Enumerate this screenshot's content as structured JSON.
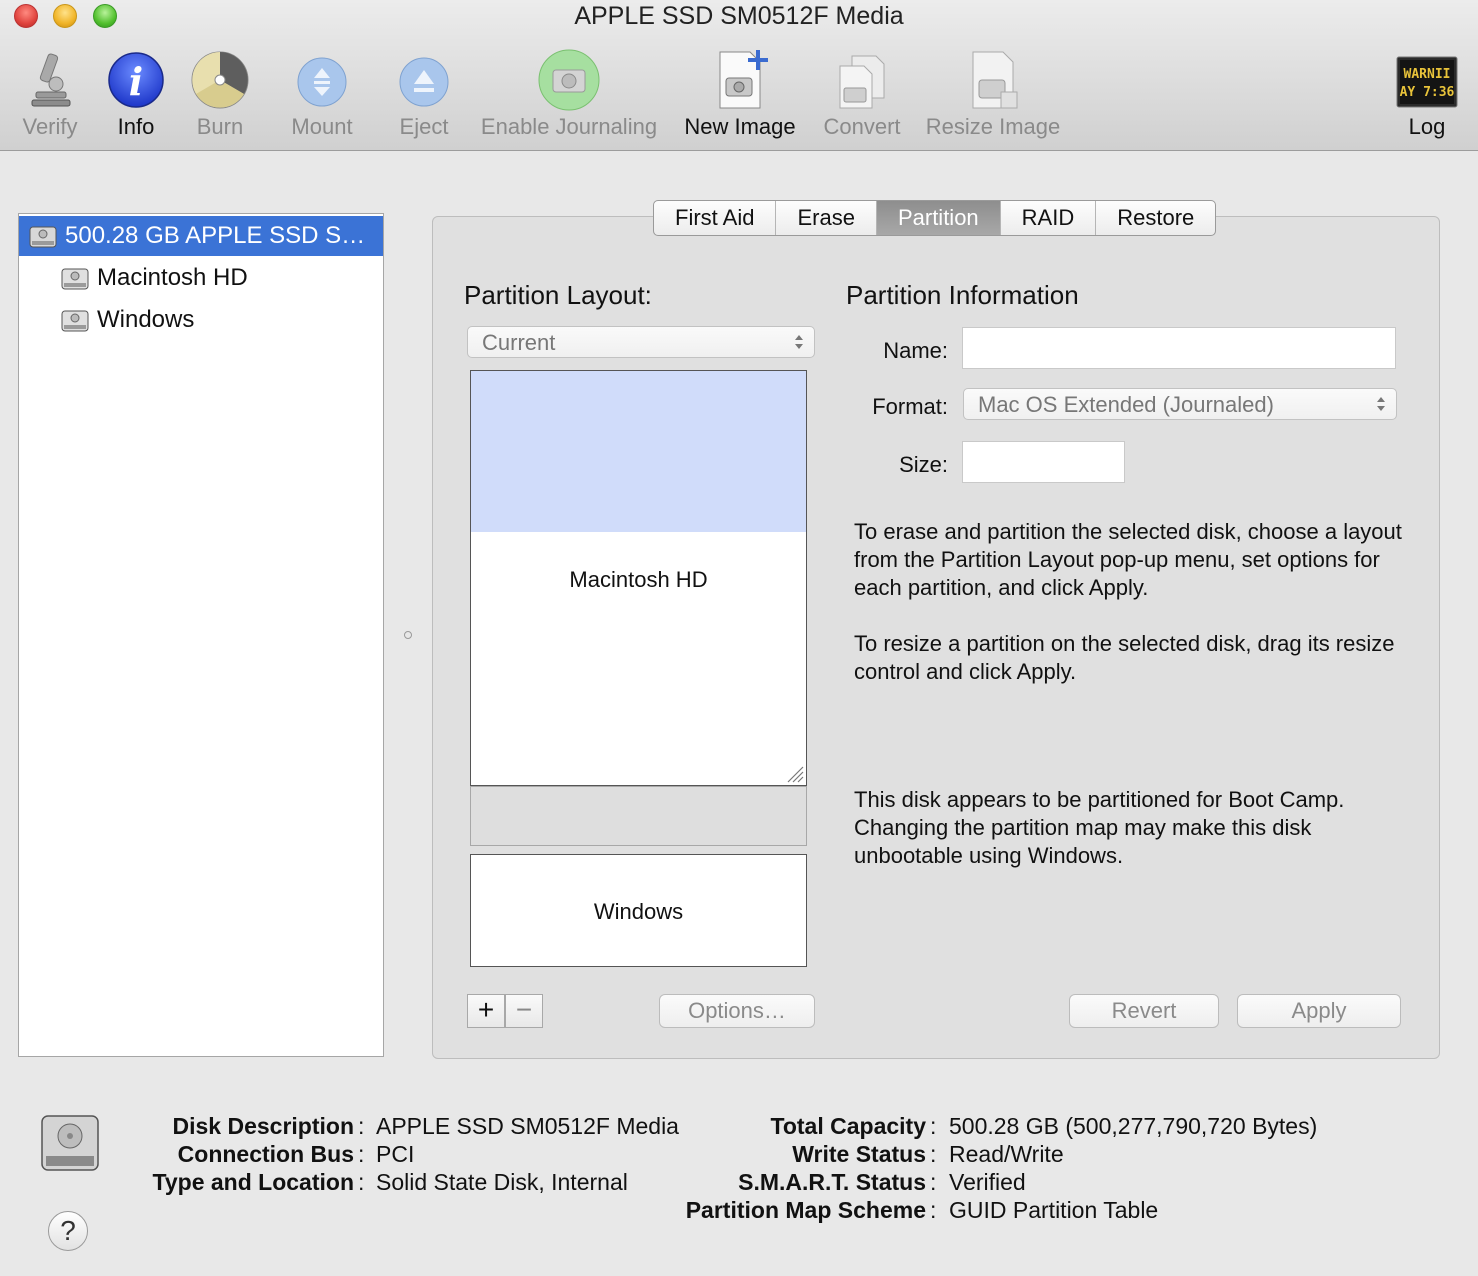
{
  "window": {
    "title": "APPLE SSD SM0512F Media"
  },
  "toolbar": {
    "verify": "Verify",
    "info": "Info",
    "burn": "Burn",
    "mount": "Mount",
    "eject": "Eject",
    "enable_journaling": "Enable Journaling",
    "new_image": "New Image",
    "convert": "Convert",
    "resize_image": "Resize Image",
    "log": "Log",
    "log_display_line1": "WARNII",
    "log_display_line2": "AY 7:36"
  },
  "sidebar": {
    "items": [
      {
        "label": "500.28 GB APPLE SSD S…",
        "selected": true
      },
      {
        "label": "Macintosh HD"
      },
      {
        "label": "Windows"
      }
    ]
  },
  "tabs": [
    "First Aid",
    "Erase",
    "Partition",
    "RAID",
    "Restore"
  ],
  "active_tab": "Partition",
  "partition_layout": {
    "heading": "Partition Layout:",
    "selected_layout": "Current",
    "partitions": [
      {
        "name": "Macintosh HD",
        "used_fraction": 0.39
      },
      {
        "name": "Windows"
      }
    ]
  },
  "partition_info": {
    "heading": "Partition Information",
    "name_label": "Name:",
    "name_value": "",
    "format_label": "Format:",
    "format_value": "Mac OS Extended (Journaled)",
    "size_label": "Size:",
    "size_value": "",
    "help_text_1": "To erase and partition the selected disk, choose a layout from the Partition Layout pop-up menu, set options for each partition, and click Apply.",
    "help_text_2": "To resize a partition on the selected disk, drag its resize control and click Apply.",
    "bootcamp_warning": "This disk appears to be partitioned for Boot Camp. Changing the partition map may make this disk unbootable using Windows."
  },
  "buttons": {
    "add": "+",
    "remove": "−",
    "options": "Options…",
    "revert": "Revert",
    "apply": "Apply"
  },
  "disk_info": {
    "separator": ":",
    "left": [
      {
        "key": "Disk Description",
        "value": "APPLE SSD SM0512F Media"
      },
      {
        "key": "Connection Bus",
        "value": "PCI"
      },
      {
        "key": "Type and Location",
        "value": "Solid State Disk, Internal"
      }
    ],
    "right": [
      {
        "key": "Total Capacity",
        "value": "500.28 GB (500,277,790,720 Bytes)"
      },
      {
        "key": "Write Status",
        "value": "Read/Write"
      },
      {
        "key": "S.M.A.R.T. Status",
        "value": "Verified"
      },
      {
        "key": "Partition Map Scheme",
        "value": "GUID Partition Table"
      }
    ]
  },
  "help_button": "?",
  "colors": {
    "selection": "#3b73d6",
    "used_space": "#d0dcfa",
    "active_tab": "#9a9a9a"
  }
}
